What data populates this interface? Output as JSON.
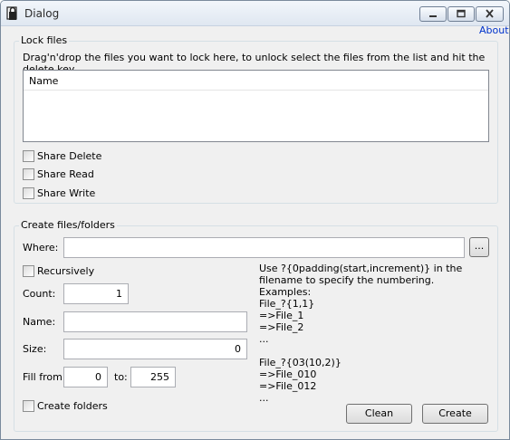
{
  "window": {
    "title": "Dialog",
    "about_link": "About"
  },
  "lock_section": {
    "title": "Lock files",
    "hint": "Drag'n'drop the files you want to lock here, to unlock select the files from the list and hit the delete key",
    "list_header": "Name",
    "checkboxes": [
      {
        "label": "Share Delete",
        "checked": false
      },
      {
        "label": "Share Read",
        "checked": false
      },
      {
        "label": "Share Write",
        "checked": false
      }
    ]
  },
  "create_section": {
    "title": "Create files/folders",
    "where_label": "Where:",
    "where_value": "",
    "browse_label": "...",
    "recursively_label": "Recursively",
    "count_label": "Count:",
    "count_value": "1",
    "name_label": "Name:",
    "name_value": "",
    "size_label": "Size:",
    "size_value": "0",
    "fill_from_label": "Fill from:",
    "fill_from_value": "0",
    "fill_to_label": "to:",
    "fill_to_value": "255",
    "create_folders_label": "Create folders",
    "help_text": "Use ?{0padding(start,increment)} in the filename to specify the numbering.\nExamples:\nFile_?{1,1}\n=>File_1\n=>File_2\n...\n\nFile_?{03(10,2)}\n=>File_010\n=>File_012\n...",
    "clean_label": "Clean",
    "create_label": "Create"
  }
}
